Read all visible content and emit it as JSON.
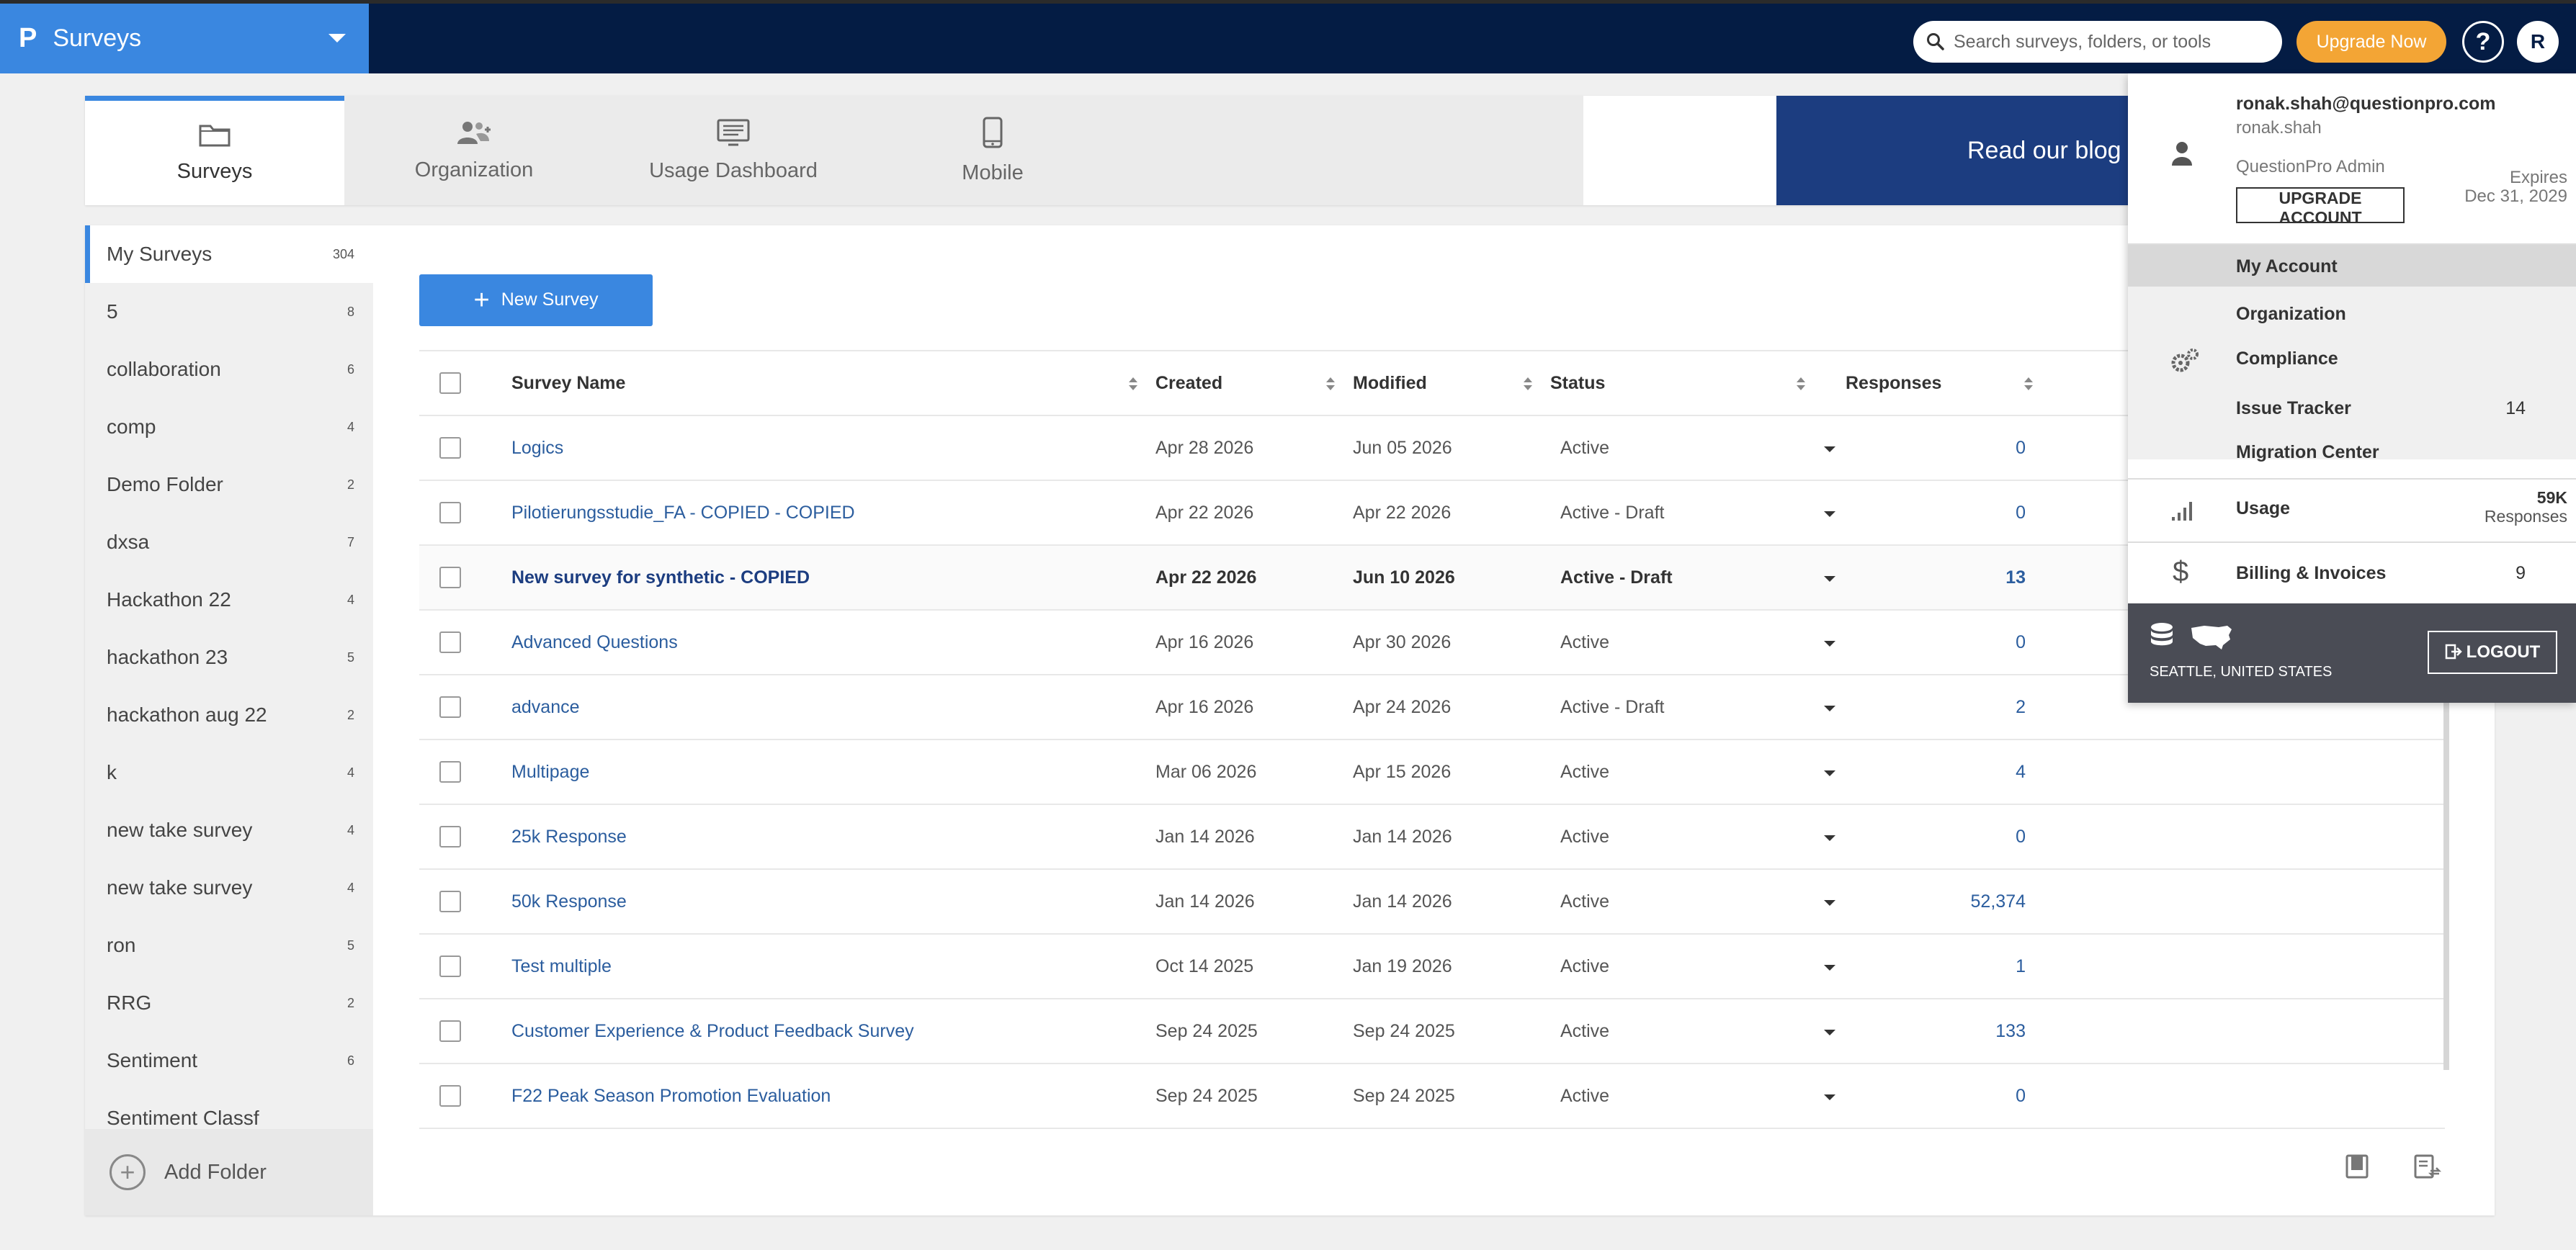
{
  "app": {
    "logo": "P",
    "name": "Surveys"
  },
  "search": {
    "placeholder": "Search surveys, folders, or tools"
  },
  "header": {
    "upgrade": "Upgrade Now",
    "help": "?",
    "avatar": "R"
  },
  "tabs": [
    {
      "label": "Surveys",
      "icon": "folder-icon"
    },
    {
      "label": "Organization",
      "icon": "users-icon"
    },
    {
      "label": "Usage Dashboard",
      "icon": "dashboard-icon"
    },
    {
      "label": "Mobile",
      "icon": "mobile-icon"
    }
  ],
  "blog": "Read our blog",
  "folders": [
    {
      "name": "My Surveys",
      "count": "304"
    },
    {
      "name": "5",
      "count": "8"
    },
    {
      "name": "collaboration",
      "count": "6"
    },
    {
      "name": "comp",
      "count": "4"
    },
    {
      "name": "Demo Folder",
      "count": "2"
    },
    {
      "name": "dxsa",
      "count": "7"
    },
    {
      "name": "Hackathon 22",
      "count": "4"
    },
    {
      "name": "hackathon 23",
      "count": "5"
    },
    {
      "name": "hackathon aug 22",
      "count": "2"
    },
    {
      "name": "k",
      "count": "4"
    },
    {
      "name": "new take survey",
      "count": "4"
    },
    {
      "name": "new take survey",
      "count": "4"
    },
    {
      "name": "ron",
      "count": "5"
    },
    {
      "name": "RRG",
      "count": "2"
    },
    {
      "name": "Sentiment",
      "count": "6"
    },
    {
      "name": "Sentiment Classf",
      "count": ""
    }
  ],
  "add_folder": "Add Folder",
  "new_survey": "New Survey",
  "columns": {
    "name": "Survey Name",
    "created": "Created",
    "modified": "Modified",
    "status": "Status",
    "responses": "Responses"
  },
  "surveys": [
    {
      "name": "Logics",
      "created": "Apr 28 2026",
      "modified": "Jun 05 2026",
      "status": "Active",
      "responses": "0"
    },
    {
      "name": "Pilotierungsstudie_FA - COPIED - COPIED",
      "created": "Apr 22 2026",
      "modified": "Apr 22 2026",
      "status": "Active - Draft",
      "responses": "0"
    },
    {
      "name": "New survey for synthetic - COPIED",
      "created": "Apr 22 2026",
      "modified": "Jun 10 2026",
      "status": "Active - Draft",
      "responses": "13"
    },
    {
      "name": "Advanced Questions",
      "created": "Apr 16 2026",
      "modified": "Apr 30 2026",
      "status": "Active",
      "responses": "0"
    },
    {
      "name": "advance",
      "created": "Apr 16 2026",
      "modified": "Apr 24 2026",
      "status": "Active - Draft",
      "responses": "2"
    },
    {
      "name": "Multipage",
      "created": "Mar 06 2026",
      "modified": "Apr 15 2026",
      "status": "Active",
      "responses": "4"
    },
    {
      "name": "25k Response",
      "created": "Jan 14 2026",
      "modified": "Jan 14 2026",
      "status": "Active",
      "responses": "0"
    },
    {
      "name": "50k Response",
      "created": "Jan 14 2026",
      "modified": "Jan 14 2026",
      "status": "Active",
      "responses": "52,374"
    },
    {
      "name": "Test multiple",
      "created": "Oct 14 2025",
      "modified": "Jan 19 2026",
      "status": "Active",
      "responses": "1"
    },
    {
      "name": "Customer Experience & Product Feedback Survey",
      "created": "Sep 24 2025",
      "modified": "Sep 24 2025",
      "status": "Active",
      "responses": "133"
    },
    {
      "name": "F22 Peak Season Promotion Evaluation",
      "created": "Sep 24 2025",
      "modified": "Sep 24 2025",
      "status": "Active",
      "responses": "0"
    }
  ],
  "account": {
    "email": "ronak.shah@questionpro.com",
    "login": "ronak.shah",
    "role": "QuestionPro Admin",
    "upgrade": "UPGRADE ACCOUNT",
    "expires_label": "Expires",
    "expires_date": "Dec 31, 2029",
    "my_account": "My Account",
    "organization": "Organization",
    "compliance": "Compliance",
    "issue_tracker": "Issue Tracker",
    "issue_count": "14",
    "migration": "Migration Center",
    "usage": "Usage",
    "usage_value": "59K",
    "usage_unit": "Responses",
    "billing": "Billing & Invoices",
    "billing_count": "9",
    "location": "SEATTLE, UNITED STATES",
    "logout": "LOGOUT"
  },
  "colors": {
    "topbar": "#041c44",
    "accent": "#3a87e0",
    "upgrade": "#f3a535",
    "blog": "#1c3d80"
  }
}
